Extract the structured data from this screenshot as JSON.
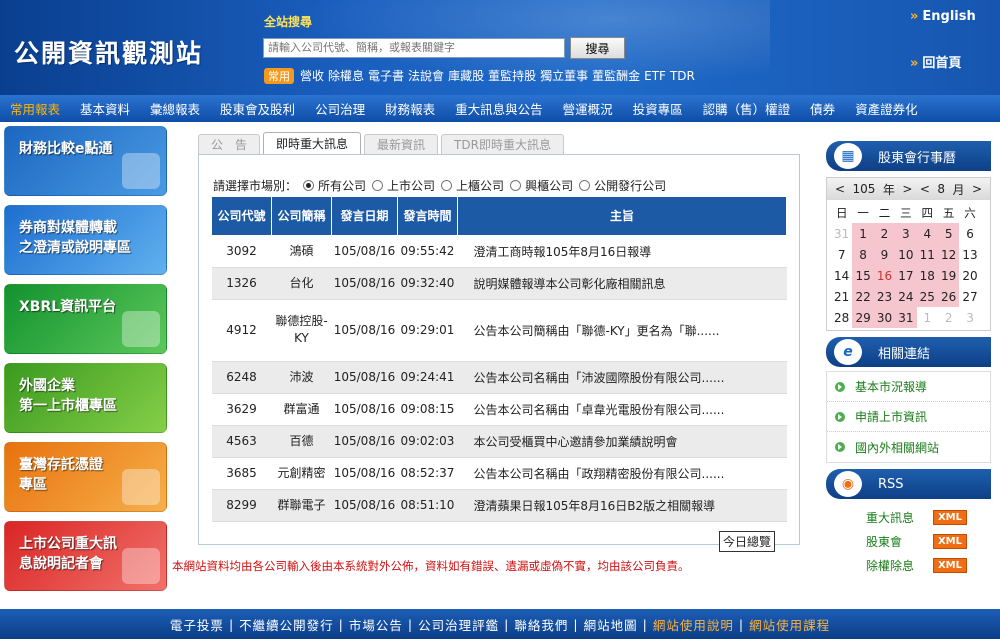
{
  "header": {
    "logo": "公開資訊觀測站",
    "search_label": "全站搜尋",
    "search_placeholder": "請輸入公司代號、簡稱，或報表關鍵字",
    "search_button": "搜尋",
    "quick_tag": "常用",
    "quick_links": [
      "營收",
      "除權息",
      "電子書",
      "法說會",
      "庫藏股",
      "董監持股",
      "獨立董事",
      "董監酬金",
      "ETF",
      "TDR"
    ],
    "english_link": "English",
    "home_link": "回首頁"
  },
  "nav": [
    "常用報表",
    "基本資料",
    "彙總報表",
    "股東會及股利",
    "公司治理",
    "財務報表",
    "重大訊息與公告",
    "營運概況",
    "投資專區",
    "認購（售）權證",
    "債券",
    "資產證券化"
  ],
  "left_banners": [
    "財務比較e點通",
    "券商對媒體轉載\n之澄清或說明專區",
    "XBRL資訊平台",
    "外國企業\n第一上市櫃專區",
    "臺灣存託憑證\n專區",
    "上市公司重大訊\n息說明記者會"
  ],
  "tabs": [
    "公　告",
    "即時重大訊息",
    "最新資訊",
    "TDR即時重大訊息"
  ],
  "market": {
    "label": "請選擇市場別：",
    "options": [
      "所有公司",
      "上市公司",
      "上櫃公司",
      "興櫃公司",
      "公開發行公司"
    ]
  },
  "table": {
    "headers": [
      "公司代號",
      "公司簡稱",
      "發言日期",
      "發言時間",
      "主旨"
    ],
    "rows": [
      {
        "code": "3092",
        "name": "鴻碩",
        "date": "105/08/16",
        "time": "09:55:42",
        "subject": "澄清工商時報105年8月16日報導"
      },
      {
        "code": "1326",
        "name": "台化",
        "date": "105/08/16",
        "time": "09:32:40",
        "subject": "說明媒體報導本公司彰化廠相關訊息"
      },
      {
        "code": "4912",
        "name": "聯德控股-KY",
        "date": "105/08/16",
        "time": "09:29:01",
        "subject": "公告本公司簡稱由「聯德-KY」更名為「聯......"
      },
      {
        "code": "6248",
        "name": "沛波",
        "date": "105/08/16",
        "time": "09:24:41",
        "subject": "公告本公司名稱由「沛波國際股份有限公司......"
      },
      {
        "code": "3629",
        "name": "群富通",
        "date": "105/08/16",
        "time": "09:08:15",
        "subject": "公告本公司名稱由「卓韋光電股份有限公司......"
      },
      {
        "code": "4563",
        "name": "百德",
        "date": "105/08/16",
        "time": "09:02:03",
        "subject": "本公司受櫃買中心邀請參加業績說明會"
      },
      {
        "code": "3685",
        "name": "元創精密",
        "date": "105/08/16",
        "time": "08:52:37",
        "subject": "公告本公司名稱由「政翔精密股份有限公司......"
      },
      {
        "code": "8299",
        "name": "群聯電子",
        "date": "105/08/16",
        "time": "08:51:10",
        "subject": "澄清蘋果日報105年8月16日B2版之相關報導"
      }
    ],
    "today_button": "今日總覽"
  },
  "disclaimer": "本網站資料均由各公司輸入後由本系統對外公佈，資料如有錯誤、遺漏或虛偽不實，均由該公司負責。",
  "calendar": {
    "title": "股東會行事曆",
    "year": "105",
    "year_unit": "年",
    "month": "8",
    "month_unit": "月",
    "weekdays": [
      "日",
      "一",
      "二",
      "三",
      "四",
      "五",
      "六"
    ],
    "days": [
      {
        "d": "31",
        "mute": true
      },
      {
        "d": "1",
        "ev": true
      },
      {
        "d": "2",
        "ev": true
      },
      {
        "d": "3",
        "ev": true
      },
      {
        "d": "4",
        "ev": true
      },
      {
        "d": "5",
        "ev": true
      },
      {
        "d": "6"
      },
      {
        "d": "7"
      },
      {
        "d": "8",
        "ev": true
      },
      {
        "d": "9",
        "ev": true
      },
      {
        "d": "10",
        "ev": true
      },
      {
        "d": "11",
        "ev": true
      },
      {
        "d": "12",
        "ev": true
      },
      {
        "d": "13"
      },
      {
        "d": "14"
      },
      {
        "d": "15",
        "ev": true
      },
      {
        "d": "16",
        "ev": true,
        "red": true
      },
      {
        "d": "17",
        "ev": true
      },
      {
        "d": "18",
        "ev": true
      },
      {
        "d": "19",
        "ev": true
      },
      {
        "d": "20"
      },
      {
        "d": "21"
      },
      {
        "d": "22",
        "ev": true
      },
      {
        "d": "23",
        "ev": true
      },
      {
        "d": "24",
        "ev": true
      },
      {
        "d": "25",
        "ev": true
      },
      {
        "d": "26",
        "ev": true
      },
      {
        "d": "27"
      },
      {
        "d": "28"
      },
      {
        "d": "29",
        "ev": true
      },
      {
        "d": "30",
        "ev": true
      },
      {
        "d": "31",
        "ev": true
      },
      {
        "d": "1",
        "mute": true
      },
      {
        "d": "2",
        "mute": true
      },
      {
        "d": "3",
        "mute": true
      }
    ]
  },
  "related": {
    "title": "相關連結",
    "links": [
      "基本市況報導",
      "申請上市資訊",
      "國內外相關網站"
    ]
  },
  "rss": {
    "title": "RSS",
    "badge": "XML",
    "items": [
      "重大訊息",
      "股東會",
      "除權除息"
    ]
  },
  "footer": {
    "links": [
      {
        "label": "電子投票",
        "hot": false
      },
      {
        "label": "不繼續公開發行",
        "hot": false
      },
      {
        "label": "市場公告",
        "hot": false
      },
      {
        "label": "公司治理評鑑",
        "hot": false
      },
      {
        "label": "聯絡我們",
        "hot": false
      },
      {
        "label": "網站地圖",
        "hot": false
      },
      {
        "label": "網站使用說明",
        "hot": true
      },
      {
        "label": "網站使用課程",
        "hot": true
      }
    ]
  },
  "colors": {
    "brand": "#1c5aa6",
    "accent": "#f39a1e",
    "event": "#f6c6cf",
    "warning": "#d01010"
  }
}
